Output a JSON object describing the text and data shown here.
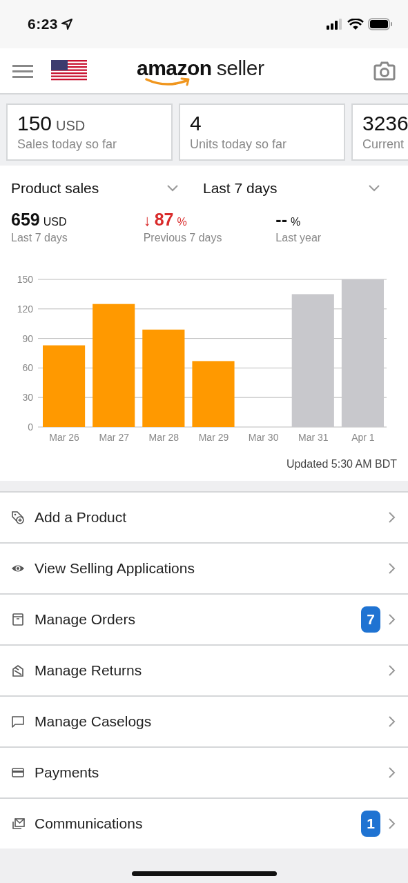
{
  "status_bar": {
    "time": "6:23"
  },
  "header": {
    "logo_word": "amazon",
    "logo_suffix": "seller"
  },
  "summary_cards": [
    {
      "value": "150",
      "unit": "USD",
      "label": "Sales today so far"
    },
    {
      "value": "4",
      "label": "Units today so far"
    },
    {
      "value": "3236",
      "label": "Current"
    }
  ],
  "filters": [
    {
      "label": "Product sales"
    },
    {
      "label": "Last 7 days"
    }
  ],
  "stats": [
    {
      "kind": "amount",
      "value": "659",
      "unit": "USD",
      "label": "Last 7 days"
    },
    {
      "kind": "down",
      "arrow": "↓",
      "value": "87",
      "unit": "%",
      "label": "Previous 7 days"
    },
    {
      "kind": "none",
      "value": "--",
      "unit": "%",
      "label": "Last year"
    }
  ],
  "chart": {
    "chart_data": {
      "type": "bar",
      "categories": [
        "Mar 26",
        "Mar 27",
        "Mar 28",
        "Mar 29",
        "Mar 30",
        "Mar 31",
        "Apr 1"
      ],
      "series": [
        {
          "color": "#ff9900",
          "values": [
            83,
            125,
            99,
            67,
            0,
            null,
            null
          ]
        },
        {
          "color": "#c8c8cc",
          "values": [
            null,
            null,
            null,
            null,
            null,
            135,
            150
          ]
        }
      ],
      "ylim": [
        0,
        150
      ],
      "yticks": [
        0,
        30,
        60,
        90,
        120,
        150
      ],
      "grid": true
    },
    "updated": "Updated 5:30 AM BDT"
  },
  "menu": [
    {
      "kind": "add-product",
      "label": "Add a Product"
    },
    {
      "kind": "eye",
      "label": "View Selling Applications"
    },
    {
      "kind": "orders",
      "label": "Manage Orders",
      "badge": "7"
    },
    {
      "kind": "returns",
      "label": "Manage Returns"
    },
    {
      "kind": "caselogs",
      "label": "Manage Caselogs"
    },
    {
      "kind": "payments",
      "label": "Payments"
    },
    {
      "kind": "communications",
      "label": "Communications",
      "badge": "1"
    }
  ]
}
